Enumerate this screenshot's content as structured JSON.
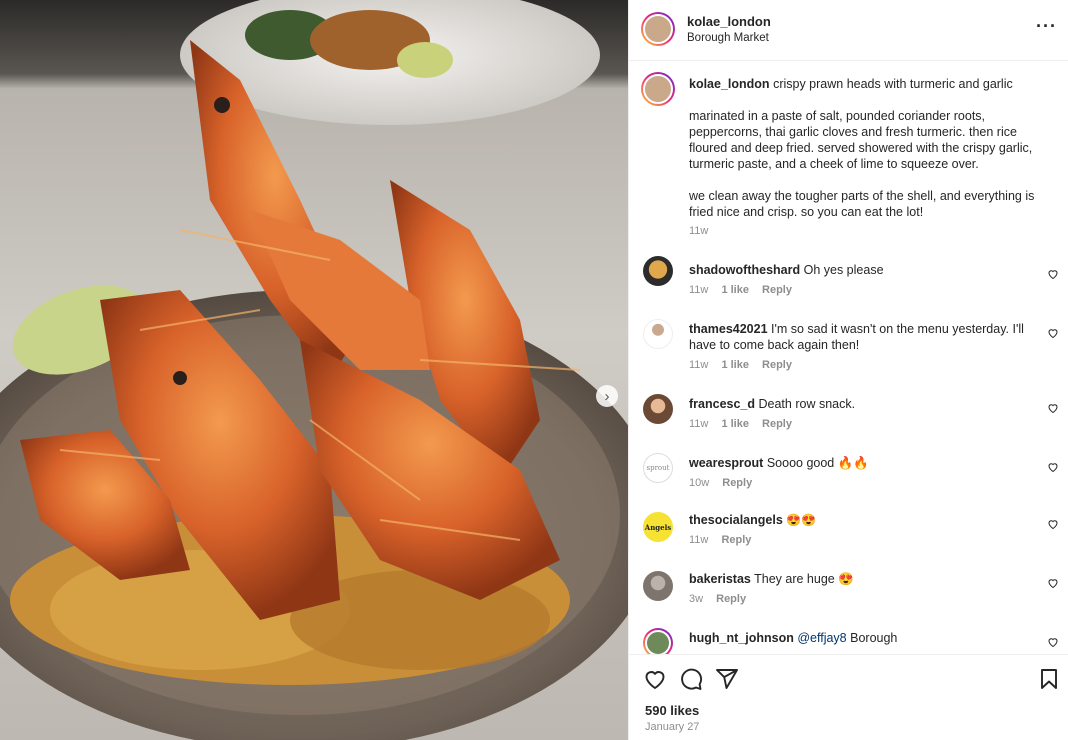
{
  "post": {
    "author": "kolae_london",
    "location": "Borough Market",
    "caption_title": "crispy prawn heads with turmeric and garlic",
    "caption_p1": "marinated in a paste of salt, pounded coriander roots, peppercorns, thai garlic cloves and fresh turmeric. then rice floured and deep fried. served showered with the crispy garlic, turmeric paste, and a cheek of lime to squeeze over.",
    "caption_p2": "we clean away the tougher parts of the shell, and everything is fried nice and crisp. so you can eat the lot!",
    "caption_age": "11w",
    "likes": "590 likes",
    "date": "January 27",
    "next_glyph": "›",
    "more_glyph": "···"
  },
  "comments": [
    {
      "user": "shadowoftheshard",
      "text": "Oh yes please",
      "age": "11w",
      "likes": "1 like",
      "reply": "Reply"
    },
    {
      "user": "thames42021",
      "text": "I'm so sad it wasn't on the menu yesterday. I'll have to come back again then!",
      "age": "11w",
      "likes": "1 like",
      "reply": "Reply"
    },
    {
      "user": "francesc_d",
      "text": "Death row snack.",
      "age": "11w",
      "likes": "1 like",
      "reply": "Reply"
    },
    {
      "user": "wearesprout",
      "text": "Soooo good 🔥🔥",
      "age": "10w",
      "reply": "Reply"
    },
    {
      "user": "thesocialangels",
      "text": "😍😍",
      "age": "11w",
      "reply": "Reply"
    },
    {
      "user": "bakeristas",
      "text": "They are huge 😍",
      "age": "3w",
      "reply": "Reply"
    },
    {
      "user": "hugh_nt_johnson",
      "mention": "@effjay8",
      "text": "Borough",
      "age": "",
      "reply": ""
    }
  ],
  "avatars": {
    "sprout_text": "sprout",
    "angels_text": "Angels"
  },
  "icons": [
    "heart-icon",
    "comment-icon",
    "share-icon",
    "bookmark-icon",
    "more-icon",
    "chevron-right-icon"
  ],
  "colors": {
    "mention": "#00376b",
    "meta": "#8e8e8e",
    "text": "#262626"
  }
}
